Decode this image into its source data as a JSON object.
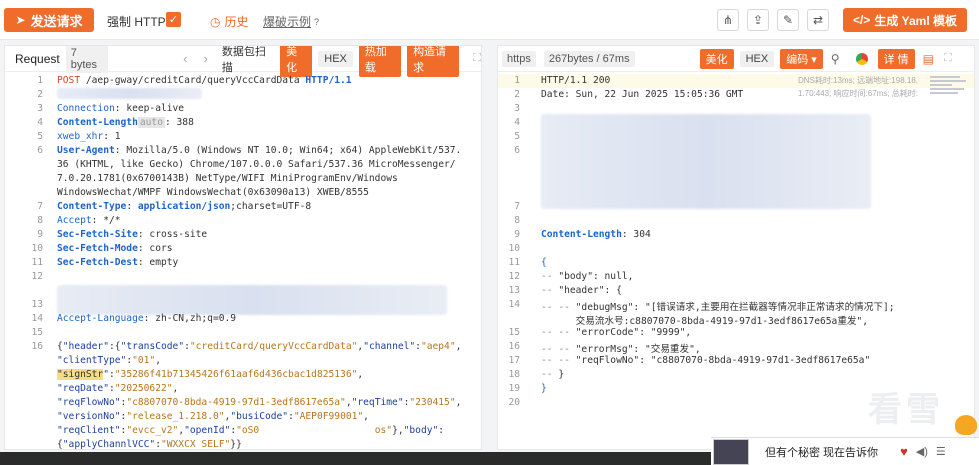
{
  "toolbar": {
    "send_label": "发送请求",
    "force_https_label": "强制 HTTPS",
    "history_label": "历史",
    "blast_label": "爆破示例",
    "yaml_label": "生成 Yaml 模板"
  },
  "request": {
    "title": "Request",
    "size": "7 bytes",
    "packet_scan": "数据包扫描",
    "beautify": "美化",
    "hex": "HEX",
    "hot_load": "热加载",
    "construct": "构造请求",
    "lines": [
      {
        "n": "1",
        "parts": [
          [
            "m",
            "POST"
          ],
          [
            "t",
            " /aep-gway/creditCard/queryVccCardData "
          ],
          [
            "kb",
            "HTTP/1.1"
          ]
        ]
      },
      {
        "n": "2",
        "parts": []
      },
      {
        "n": "3",
        "parts": [
          [
            "k",
            "Connection"
          ],
          [
            "t",
            ": keep-alive"
          ]
        ]
      },
      {
        "n": "4",
        "parts": [
          [
            "kb",
            "Content-Length"
          ],
          [
            "tag",
            "auto"
          ],
          [
            "t",
            ": 388"
          ]
        ]
      },
      {
        "n": "5",
        "parts": [
          [
            "k",
            "xweb_xhr"
          ],
          [
            "t",
            ": 1"
          ]
        ]
      },
      {
        "n": "6",
        "parts": [
          [
            "kb",
            "User-Agent"
          ],
          [
            "t",
            ": Mozilla/5.0 (Windows NT 10.0; Win64; x64) AppleWebKit/537."
          ]
        ]
      },
      {
        "n": "",
        "parts": [
          [
            "t",
            "36 (KHTML, like Gecko) Chrome/107.0.0.0 Safari/537.36 MicroMessenger/"
          ]
        ]
      },
      {
        "n": "",
        "parts": [
          [
            "t",
            "7.0.20.1781(0x6700143B) NetType/WIFI MiniProgramEnv/Windows"
          ]
        ]
      },
      {
        "n": "",
        "parts": [
          [
            "t",
            "WindowsWechat/WMPF WindowsWechat(0x63090a13) XWEB/8555"
          ]
        ]
      },
      {
        "n": "7",
        "parts": [
          [
            "kb",
            "Content-Type"
          ],
          [
            "t",
            ": "
          ],
          [
            "kb",
            "application/json"
          ],
          [
            "t",
            ";charset=UTF-8"
          ]
        ]
      },
      {
        "n": "8",
        "parts": [
          [
            "k",
            "Accept"
          ],
          [
            "t",
            ": */*"
          ]
        ]
      },
      {
        "n": "9",
        "parts": [
          [
            "kb",
            "Sec-Fetch-Site"
          ],
          [
            "t",
            ": cross-site"
          ]
        ]
      },
      {
        "n": "10",
        "parts": [
          [
            "kb",
            "Sec-Fetch-Mode"
          ],
          [
            "t",
            ": cors"
          ]
        ]
      },
      {
        "n": "11",
        "parts": [
          [
            "kb",
            "Sec-Fetch-Dest"
          ],
          [
            "t",
            ": empty"
          ]
        ]
      },
      {
        "n": "12",
        "parts": []
      },
      {
        "n": "",
        "parts": []
      },
      {
        "n": "13",
        "parts": []
      },
      {
        "n": "14",
        "parts": [
          [
            "k",
            "Accept-Language"
          ],
          [
            "t",
            ": zh-CN,zh;q=0.9"
          ]
        ]
      },
      {
        "n": "15",
        "parts": []
      },
      {
        "n": "16",
        "parts": [
          [
            "t",
            "{"
          ],
          [
            "jk",
            "\"header\""
          ],
          [
            "t",
            ":{"
          ],
          [
            "jk",
            "\"transCode\""
          ],
          [
            "t",
            ":"
          ],
          [
            "str",
            "\"creditCard/queryVccCardData\""
          ],
          [
            "t",
            ","
          ],
          [
            "jk",
            "\"channel\""
          ],
          [
            "t",
            ":"
          ],
          [
            "str",
            "\"aep4\""
          ],
          [
            "t",
            ","
          ]
        ]
      },
      {
        "n": "",
        "parts": [
          [
            "jk",
            "\"clientType\""
          ],
          [
            "t",
            ":"
          ],
          [
            "str",
            "\"01\""
          ],
          [
            "t",
            ","
          ]
        ]
      },
      {
        "n": "",
        "parts": [
          [
            "hl",
            "\"signStr"
          ],
          [
            "jk",
            "\""
          ],
          [
            "t",
            ":"
          ],
          [
            "str",
            "\"35286f41b71345426f61aaf6d436cbac1d825136\""
          ],
          [
            "t",
            ","
          ]
        ]
      },
      {
        "n": "",
        "parts": [
          [
            "jk",
            "\"reqDate\""
          ],
          [
            "t",
            ":"
          ],
          [
            "str",
            "\"20250622\""
          ],
          [
            "t",
            ","
          ]
        ]
      },
      {
        "n": "",
        "parts": [
          [
            "jk",
            "\"reqFlowNo\""
          ],
          [
            "t",
            ":"
          ],
          [
            "str",
            "\"c8807070-8bda-4919-97d1-3edf8617e65a\""
          ],
          [
            "t",
            ","
          ],
          [
            "jk",
            "\"reqTime\""
          ],
          [
            "t",
            ":"
          ],
          [
            "str",
            "\"230415\""
          ],
          [
            "t",
            ","
          ]
        ]
      },
      {
        "n": "",
        "parts": [
          [
            "jk",
            "\"versionNo\""
          ],
          [
            "t",
            ":"
          ],
          [
            "str",
            "\"release_1.218.0\""
          ],
          [
            "t",
            ","
          ],
          [
            "jk",
            "\"busiCode\""
          ],
          [
            "t",
            ":"
          ],
          [
            "str",
            "\"AEP0F99001\""
          ],
          [
            "t",
            ","
          ]
        ]
      },
      {
        "n": "",
        "parts": [
          [
            "jk",
            "\"reqClient\""
          ],
          [
            "t",
            ":"
          ],
          [
            "str",
            "\"evcc_v2\""
          ],
          [
            "t",
            ","
          ],
          [
            "jk",
            "\"openId\""
          ],
          [
            "t",
            ":"
          ],
          [
            "str",
            "\"oS0"
          ],
          [
            "t",
            "                    "
          ],
          [
            "str",
            "os\""
          ],
          [
            "t",
            "},"
          ],
          [
            "jk",
            "\"body\""
          ],
          [
            "t",
            ":"
          ]
        ]
      },
      {
        "n": "",
        "parts": [
          [
            "t",
            "{"
          ],
          [
            "jk",
            "\"applyChannlVCC\""
          ],
          [
            "t",
            ":"
          ],
          [
            "str",
            "\"WXXCX_SELF\""
          ],
          [
            "t",
            "}}"
          ]
        ]
      }
    ]
  },
  "response": {
    "proto": "https",
    "size": "267bytes / 67ms",
    "beautify": "美化",
    "hex": "HEX",
    "encoding": "编码",
    "detail": "详 情",
    "dns_line1": "DNS耗时:13ms; 远端地址:198.18.",
    "dns_line2": "1.70:443; 响应时间:67ms; 总耗时:",
    "watermark": "看雪",
    "lines": [
      {
        "n": "1",
        "parts": [
          [
            "t",
            "HTTP/1.1 200"
          ]
        ]
      },
      {
        "n": "2",
        "parts": [
          [
            "t",
            "Date: Sun, 22 Jun 2025 15:05:36 GMT"
          ]
        ]
      },
      {
        "n": "3",
        "parts": []
      },
      {
        "n": "4",
        "parts": []
      },
      {
        "n": "5",
        "parts": []
      },
      {
        "n": "6",
        "parts": []
      },
      {
        "n": "",
        "parts": []
      },
      {
        "n": "",
        "parts": []
      },
      {
        "n": "",
        "parts": []
      },
      {
        "n": "7",
        "parts": []
      },
      {
        "n": "8",
        "parts": []
      },
      {
        "n": "9",
        "parts": [
          [
            "kb",
            "Content-Length"
          ],
          [
            "t",
            ": 304"
          ]
        ]
      },
      {
        "n": "10",
        "parts": []
      },
      {
        "n": "11",
        "parts": [
          [
            "k",
            "{"
          ]
        ]
      },
      {
        "n": "12",
        "parts": [
          [
            "grey",
            "-- "
          ],
          [
            "t",
            "\"body\": null,"
          ]
        ]
      },
      {
        "n": "13",
        "parts": [
          [
            "grey",
            "-- "
          ],
          [
            "t",
            "\"header\": {"
          ]
        ]
      },
      {
        "n": "14",
        "parts": [
          [
            "grey",
            "-- -- "
          ],
          [
            "t",
            "\"debugMsg\": \"[错误请求,主要用在拦截器等情况非正常请求的情况下];"
          ]
        ]
      },
      {
        "n": "",
        "parts": [
          [
            "t",
            "      交易流水号:c8807070-8bda-4919-97d1-3edf8617e65a重发\","
          ]
        ]
      },
      {
        "n": "15",
        "parts": [
          [
            "grey",
            "-- -- "
          ],
          [
            "t",
            "\"errorCode\": \"9999\","
          ]
        ]
      },
      {
        "n": "16",
        "parts": [
          [
            "grey",
            "-- -- "
          ],
          [
            "t",
            "\"errorMsg\": \"交易重发\","
          ]
        ]
      },
      {
        "n": "17",
        "parts": [
          [
            "grey",
            "-- -- "
          ],
          [
            "t",
            "\"reqFlowNo\": \"c8807070-8bda-4919-97d1-3edf8617e65a\""
          ]
        ]
      },
      {
        "n": "18",
        "parts": [
          [
            "grey",
            "-- "
          ],
          [
            "t",
            "}"
          ]
        ]
      },
      {
        "n": "19",
        "parts": [
          [
            "k",
            "}"
          ]
        ]
      },
      {
        "n": "20",
        "parts": []
      }
    ]
  },
  "notification": {
    "text": "但有个秘密 现在告诉你"
  }
}
